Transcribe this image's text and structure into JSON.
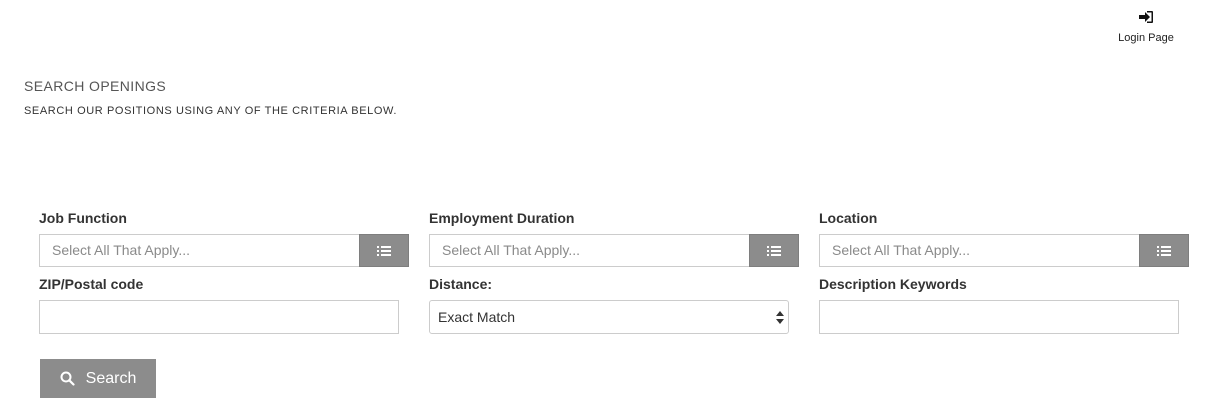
{
  "header": {
    "login_label": "Login Page"
  },
  "intro": {
    "title": "SEARCH OPENINGS",
    "subtitle": "SEARCH OUR POSITIONS USING ANY OF THE CRITERIA BELOW."
  },
  "form": {
    "job_function": {
      "label": "Job Function",
      "placeholder": "Select All That Apply..."
    },
    "employment_duration": {
      "label": "Employment Duration",
      "placeholder": "Select All That Apply..."
    },
    "location": {
      "label": "Location",
      "placeholder": "Select All That Apply..."
    },
    "zip": {
      "label": "ZIP/Postal code",
      "value": ""
    },
    "distance": {
      "label": "Distance:",
      "selected": "Exact Match"
    },
    "keywords": {
      "label": "Description Keywords",
      "value": ""
    }
  },
  "actions": {
    "search_label": "Search"
  },
  "colors": {
    "button_gray": "#8c8c8c",
    "border": "#cccccc",
    "placeholder_text": "#8a8a8a"
  },
  "icons": {
    "login": "sign-in-icon",
    "list": "list-icon",
    "search": "search-icon",
    "select_arrows": "sort-arrows-icon"
  }
}
